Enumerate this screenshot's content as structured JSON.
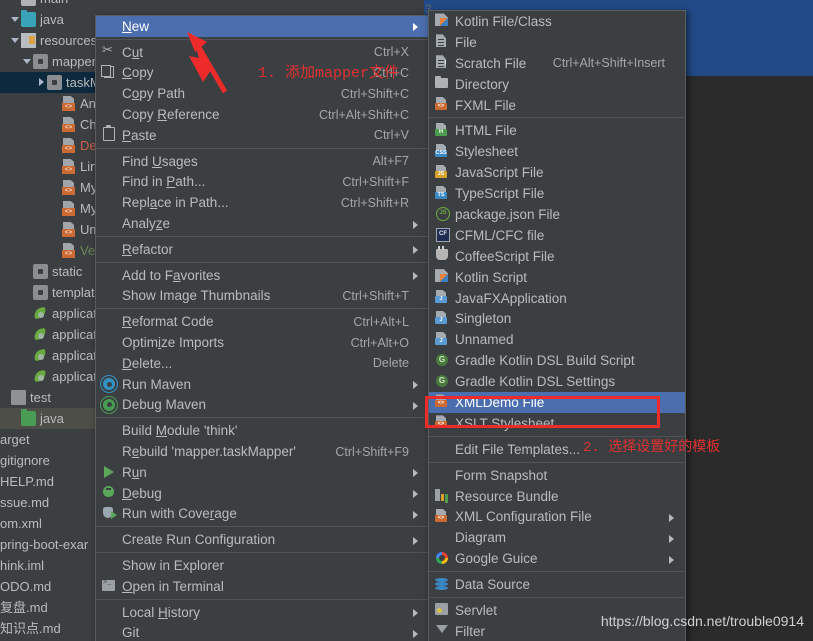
{
  "editor": {
    "gutter_line_number": "3"
  },
  "sidebar": {
    "items": [
      {
        "label": "main",
        "indent": 10,
        "icon": "folder-icon",
        "twisty": "none",
        "color": "white",
        "state": "partial-top"
      },
      {
        "label": "java",
        "indent": 10,
        "icon": "folder-java-icon",
        "twisty": "down",
        "color": "white"
      },
      {
        "label": "resources",
        "indent": 10,
        "icon": "resources-folder-icon",
        "twisty": "down",
        "color": "white"
      },
      {
        "label": "mapper",
        "indent": 22,
        "icon": "package-icon",
        "twisty": "down",
        "color": "white"
      },
      {
        "label": "taskM",
        "indent": 36,
        "icon": "package-icon",
        "twisty": "right",
        "color": "white",
        "selected": "dark"
      },
      {
        "label": "Analy",
        "indent": 50,
        "icon": "xml-file-icon",
        "twisty": "none",
        "color": "white"
      },
      {
        "label": "Chan",
        "indent": 50,
        "icon": "xml-file-icon",
        "twisty": "none",
        "color": "white"
      },
      {
        "label": "Deliv",
        "indent": 50,
        "icon": "xml-file-icon",
        "twisty": "none",
        "color": "red"
      },
      {
        "label": "LineM",
        "indent": 50,
        "icon": "xml-file-icon",
        "twisty": "none",
        "color": "white"
      },
      {
        "label": "Myba",
        "indent": 50,
        "icon": "xml-file-icon",
        "twisty": "none",
        "color": "white"
      },
      {
        "label": "Myba",
        "indent": 50,
        "icon": "xml-file-icon",
        "twisty": "none",
        "color": "white"
      },
      {
        "label": "Umsl",
        "indent": 50,
        "icon": "xml-file-icon",
        "twisty": "none",
        "color": "white"
      },
      {
        "label": "Vehic",
        "indent": 50,
        "icon": "xml-file-icon",
        "twisty": "none",
        "color": "green"
      },
      {
        "label": "static",
        "indent": 22,
        "icon": "package-icon",
        "twisty": "none",
        "color": "white"
      },
      {
        "label": "template",
        "indent": 22,
        "icon": "package-icon",
        "twisty": "none",
        "color": "white"
      },
      {
        "label": "applicat",
        "indent": 22,
        "icon": "spring-leaf-icon",
        "twisty": "none",
        "color": "white"
      },
      {
        "label": "applicat",
        "indent": 22,
        "icon": "spring-leaf-icon",
        "twisty": "none",
        "color": "white"
      },
      {
        "label": "applicat",
        "indent": 22,
        "icon": "spring-leaf-icon",
        "twisty": "none",
        "color": "white"
      },
      {
        "label": "applicat",
        "indent": 22,
        "icon": "spring-leaf-icon",
        "twisty": "none",
        "color": "white"
      },
      {
        "label": "test",
        "indent": 0,
        "icon": "test-folder-icon",
        "twisty": "none",
        "color": "white"
      },
      {
        "label": "java",
        "indent": 10,
        "icon": "folder-green-icon",
        "twisty": "none",
        "color": "white",
        "selected": "gray"
      }
    ],
    "flat_items": [
      {
        "label": "arget"
      },
      {
        "label": "gitignore"
      },
      {
        "label": "HELP.md"
      },
      {
        "label": "ssue.md"
      },
      {
        "label": "om.xml"
      },
      {
        "label": "pring-boot-exar"
      },
      {
        "label": "hink.iml"
      },
      {
        "label": "ODO.md"
      },
      {
        "label": "复盘.md"
      },
      {
        "label": "知识点.md"
      }
    ]
  },
  "context_menu": {
    "items": [
      {
        "label": "New",
        "shortcut": "",
        "arrow": true,
        "icon": null,
        "highlight": true,
        "mn": 0
      },
      {
        "sep": true
      },
      {
        "label": "Cut",
        "shortcut": "Ctrl+X",
        "arrow": false,
        "icon": "cut-icon",
        "mn": 1
      },
      {
        "label": "Copy",
        "shortcut": "Ctrl+C",
        "arrow": false,
        "icon": "copy-icon",
        "mn": 0
      },
      {
        "label": "Copy Path",
        "shortcut": "Ctrl+Shift+C",
        "arrow": false,
        "icon": null,
        "mn": 1
      },
      {
        "label": "Copy Reference",
        "shortcut": "Ctrl+Alt+Shift+C",
        "arrow": false,
        "icon": null,
        "mn": 5
      },
      {
        "label": "Paste",
        "shortcut": "Ctrl+V",
        "arrow": false,
        "icon": "paste-icon",
        "mn": 0
      },
      {
        "sep": true
      },
      {
        "label": "Find Usages",
        "shortcut": "Alt+F7",
        "arrow": false,
        "icon": null,
        "mn": 5
      },
      {
        "label": "Find in Path...",
        "shortcut": "Ctrl+Shift+F",
        "arrow": false,
        "icon": null,
        "mn": 8
      },
      {
        "label": "Replace in Path...",
        "shortcut": "Ctrl+Shift+R",
        "arrow": false,
        "icon": null,
        "mn": 4
      },
      {
        "label": "Analyze",
        "shortcut": "",
        "arrow": true,
        "icon": null,
        "mn": 5
      },
      {
        "sep": true
      },
      {
        "label": "Refactor",
        "shortcut": "",
        "arrow": true,
        "icon": null,
        "mn": 0
      },
      {
        "sep": true
      },
      {
        "label": "Add to Favorites",
        "shortcut": "",
        "arrow": true,
        "icon": null,
        "mn": 8
      },
      {
        "label": "Show Image Thumbnails",
        "shortcut": "Ctrl+Shift+T",
        "arrow": false,
        "icon": null,
        "mn": -1
      },
      {
        "sep": true
      },
      {
        "label": "Reformat Code",
        "shortcut": "Ctrl+Alt+L",
        "arrow": false,
        "icon": null,
        "mn": 0
      },
      {
        "label": "Optimize Imports",
        "shortcut": "Ctrl+Alt+O",
        "arrow": false,
        "icon": null,
        "mn": 5
      },
      {
        "label": "Delete...",
        "shortcut": "Delete",
        "arrow": false,
        "icon": null,
        "mn": 0
      },
      {
        "label": "Run Maven",
        "shortcut": "",
        "arrow": true,
        "icon": "maven-run-icon",
        "mn": -1
      },
      {
        "label": "Debug Maven",
        "shortcut": "",
        "arrow": true,
        "icon": "maven-debug-icon",
        "mn": -1
      },
      {
        "sep": true
      },
      {
        "label": "Build Module 'think'",
        "shortcut": "",
        "arrow": false,
        "icon": null,
        "mn": 6
      },
      {
        "label": "Rebuild 'mapper.taskMapper'",
        "shortcut": "Ctrl+Shift+F9",
        "arrow": false,
        "icon": null,
        "mn": 1
      },
      {
        "label": "Run",
        "shortcut": "",
        "arrow": true,
        "icon": "run-icon",
        "mn": 1
      },
      {
        "label": "Debug",
        "shortcut": "",
        "arrow": true,
        "icon": "debug-icon",
        "mn": 0
      },
      {
        "label": "Run with Coverage",
        "shortcut": "",
        "arrow": true,
        "icon": "coverage-icon",
        "mn": 13
      },
      {
        "sep": true
      },
      {
        "label": "Create Run Configuration",
        "shortcut": "",
        "arrow": true,
        "icon": null,
        "mn": -1
      },
      {
        "sep": true
      },
      {
        "label": "Show in Explorer",
        "shortcut": "",
        "arrow": false,
        "icon": null,
        "mn": -1
      },
      {
        "label": "Open in Terminal",
        "shortcut": "",
        "arrow": false,
        "icon": "terminal-icon",
        "mn": 0
      },
      {
        "sep": true
      },
      {
        "label": "Local History",
        "shortcut": "",
        "arrow": true,
        "icon": null,
        "mn": 6
      },
      {
        "label": "Git",
        "shortcut": "",
        "arrow": true,
        "icon": null,
        "mn": -1
      }
    ]
  },
  "submenu": {
    "items": [
      {
        "label": "Kotlin File/Class",
        "shortcut": "",
        "arrow": false,
        "icon": "kotlin-file-icon"
      },
      {
        "label": "File",
        "shortcut": "",
        "arrow": false,
        "icon": "plain-file-icon"
      },
      {
        "label": "Scratch File",
        "shortcut": "Ctrl+Alt+Shift+Insert",
        "arrow": false,
        "icon": "scratch-file-icon"
      },
      {
        "label": "Directory",
        "shortcut": "",
        "arrow": false,
        "icon": "directory-icon"
      },
      {
        "label": "FXML File",
        "shortcut": "",
        "arrow": false,
        "icon": "xml-file-icon"
      },
      {
        "sep": true
      },
      {
        "label": "HTML File",
        "shortcut": "",
        "arrow": false,
        "icon": "html-file-icon"
      },
      {
        "label": "Stylesheet",
        "shortcut": "",
        "arrow": false,
        "icon": "css-file-icon"
      },
      {
        "label": "JavaScript File",
        "shortcut": "",
        "arrow": false,
        "icon": "js-file-icon"
      },
      {
        "label": "TypeScript File",
        "shortcut": "",
        "arrow": false,
        "icon": "ts-file-icon"
      },
      {
        "label": "package.json File",
        "shortcut": "",
        "arrow": false,
        "icon": "node-icon"
      },
      {
        "label": "CFML/CFC file",
        "shortcut": "",
        "arrow": false,
        "icon": "cfml-icon"
      },
      {
        "label": "CoffeeScript File",
        "shortcut": "",
        "arrow": false,
        "icon": "coffeescript-icon"
      },
      {
        "label": "Kotlin Script",
        "shortcut": "",
        "arrow": false,
        "icon": "kotlin-script-icon"
      },
      {
        "label": "JavaFXApplication",
        "shortcut": "",
        "arrow": false,
        "icon": "java-file-icon"
      },
      {
        "label": "Singleton",
        "shortcut": "",
        "arrow": false,
        "icon": "java-file-icon"
      },
      {
        "label": "Unnamed",
        "shortcut": "",
        "arrow": false,
        "icon": "java-file-icon"
      },
      {
        "label": "Gradle Kotlin DSL Build Script",
        "shortcut": "",
        "arrow": false,
        "icon": "gradle-icon"
      },
      {
        "label": "Gradle Kotlin DSL Settings",
        "shortcut": "",
        "arrow": false,
        "icon": "gradle-icon"
      },
      {
        "label": "XMLDemo File",
        "shortcut": "",
        "arrow": false,
        "icon": "xml-file-icon",
        "highlight": true
      },
      {
        "label": "XSLT Stylesheet",
        "shortcut": "",
        "arrow": false,
        "icon": "xml-file-icon"
      },
      {
        "sep": true
      },
      {
        "label": "Edit File Templates...",
        "shortcut": "",
        "arrow": false,
        "icon": null
      },
      {
        "sep": true
      },
      {
        "label": "Form Snapshot",
        "shortcut": "",
        "arrow": false,
        "icon": null
      },
      {
        "label": "Resource Bundle",
        "shortcut": "",
        "arrow": false,
        "icon": "resource-bundle-icon"
      },
      {
        "label": "XML Configuration File",
        "shortcut": "",
        "arrow": true,
        "icon": "xml-file-icon"
      },
      {
        "label": "Diagram",
        "shortcut": "",
        "arrow": true,
        "icon": null
      },
      {
        "label": "Google Guice",
        "shortcut": "",
        "arrow": true,
        "icon": "google-icon"
      },
      {
        "sep": true
      },
      {
        "label": "Data Source",
        "shortcut": "",
        "arrow": false,
        "icon": "data-source-icon"
      },
      {
        "sep": true
      },
      {
        "label": "Servlet",
        "shortcut": "",
        "arrow": false,
        "icon": "servlet-icon"
      },
      {
        "label": "Filter",
        "shortcut": "",
        "arrow": false,
        "icon": "filter-icon"
      }
    ]
  },
  "annotations": {
    "step1": "1. 添加mapper文件",
    "step2": "2. 选择设置好的模板",
    "accent_color": "#e03030",
    "highlight_box_color": "#ee2b2b"
  },
  "watermark": {
    "text": "https://blog.csdn.net/trouble0914"
  }
}
